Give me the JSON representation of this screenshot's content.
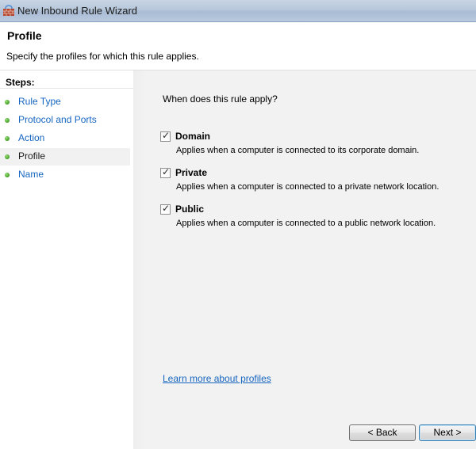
{
  "window": {
    "title": "New Inbound Rule Wizard"
  },
  "header": {
    "title": "Profile",
    "subtitle": "Specify the profiles for which this rule applies."
  },
  "steps": {
    "label": "Steps:",
    "items": [
      {
        "label": "Rule Type",
        "current": false
      },
      {
        "label": "Protocol and Ports",
        "current": false
      },
      {
        "label": "Action",
        "current": false
      },
      {
        "label": "Profile",
        "current": true
      },
      {
        "label": "Name",
        "current": false
      }
    ]
  },
  "content": {
    "question": "When does this rule apply?",
    "options": [
      {
        "label": "Domain",
        "description": "Applies when a computer is connected to its corporate domain.",
        "checked": true
      },
      {
        "label": "Private",
        "description": "Applies when a computer is connected to a private network location.",
        "checked": true
      },
      {
        "label": "Public",
        "description": "Applies when a computer is connected to a public network location.",
        "checked": true
      }
    ],
    "learn_more": "Learn more about profiles"
  },
  "buttons": {
    "back": "< Back",
    "next": "Next >"
  },
  "colors": {
    "link": "#1565c0",
    "step_dot": "#4aa62c"
  },
  "icons": {
    "app": "firewall-icon",
    "step": "green-dot-icon",
    "check": "checkmark-icon"
  }
}
